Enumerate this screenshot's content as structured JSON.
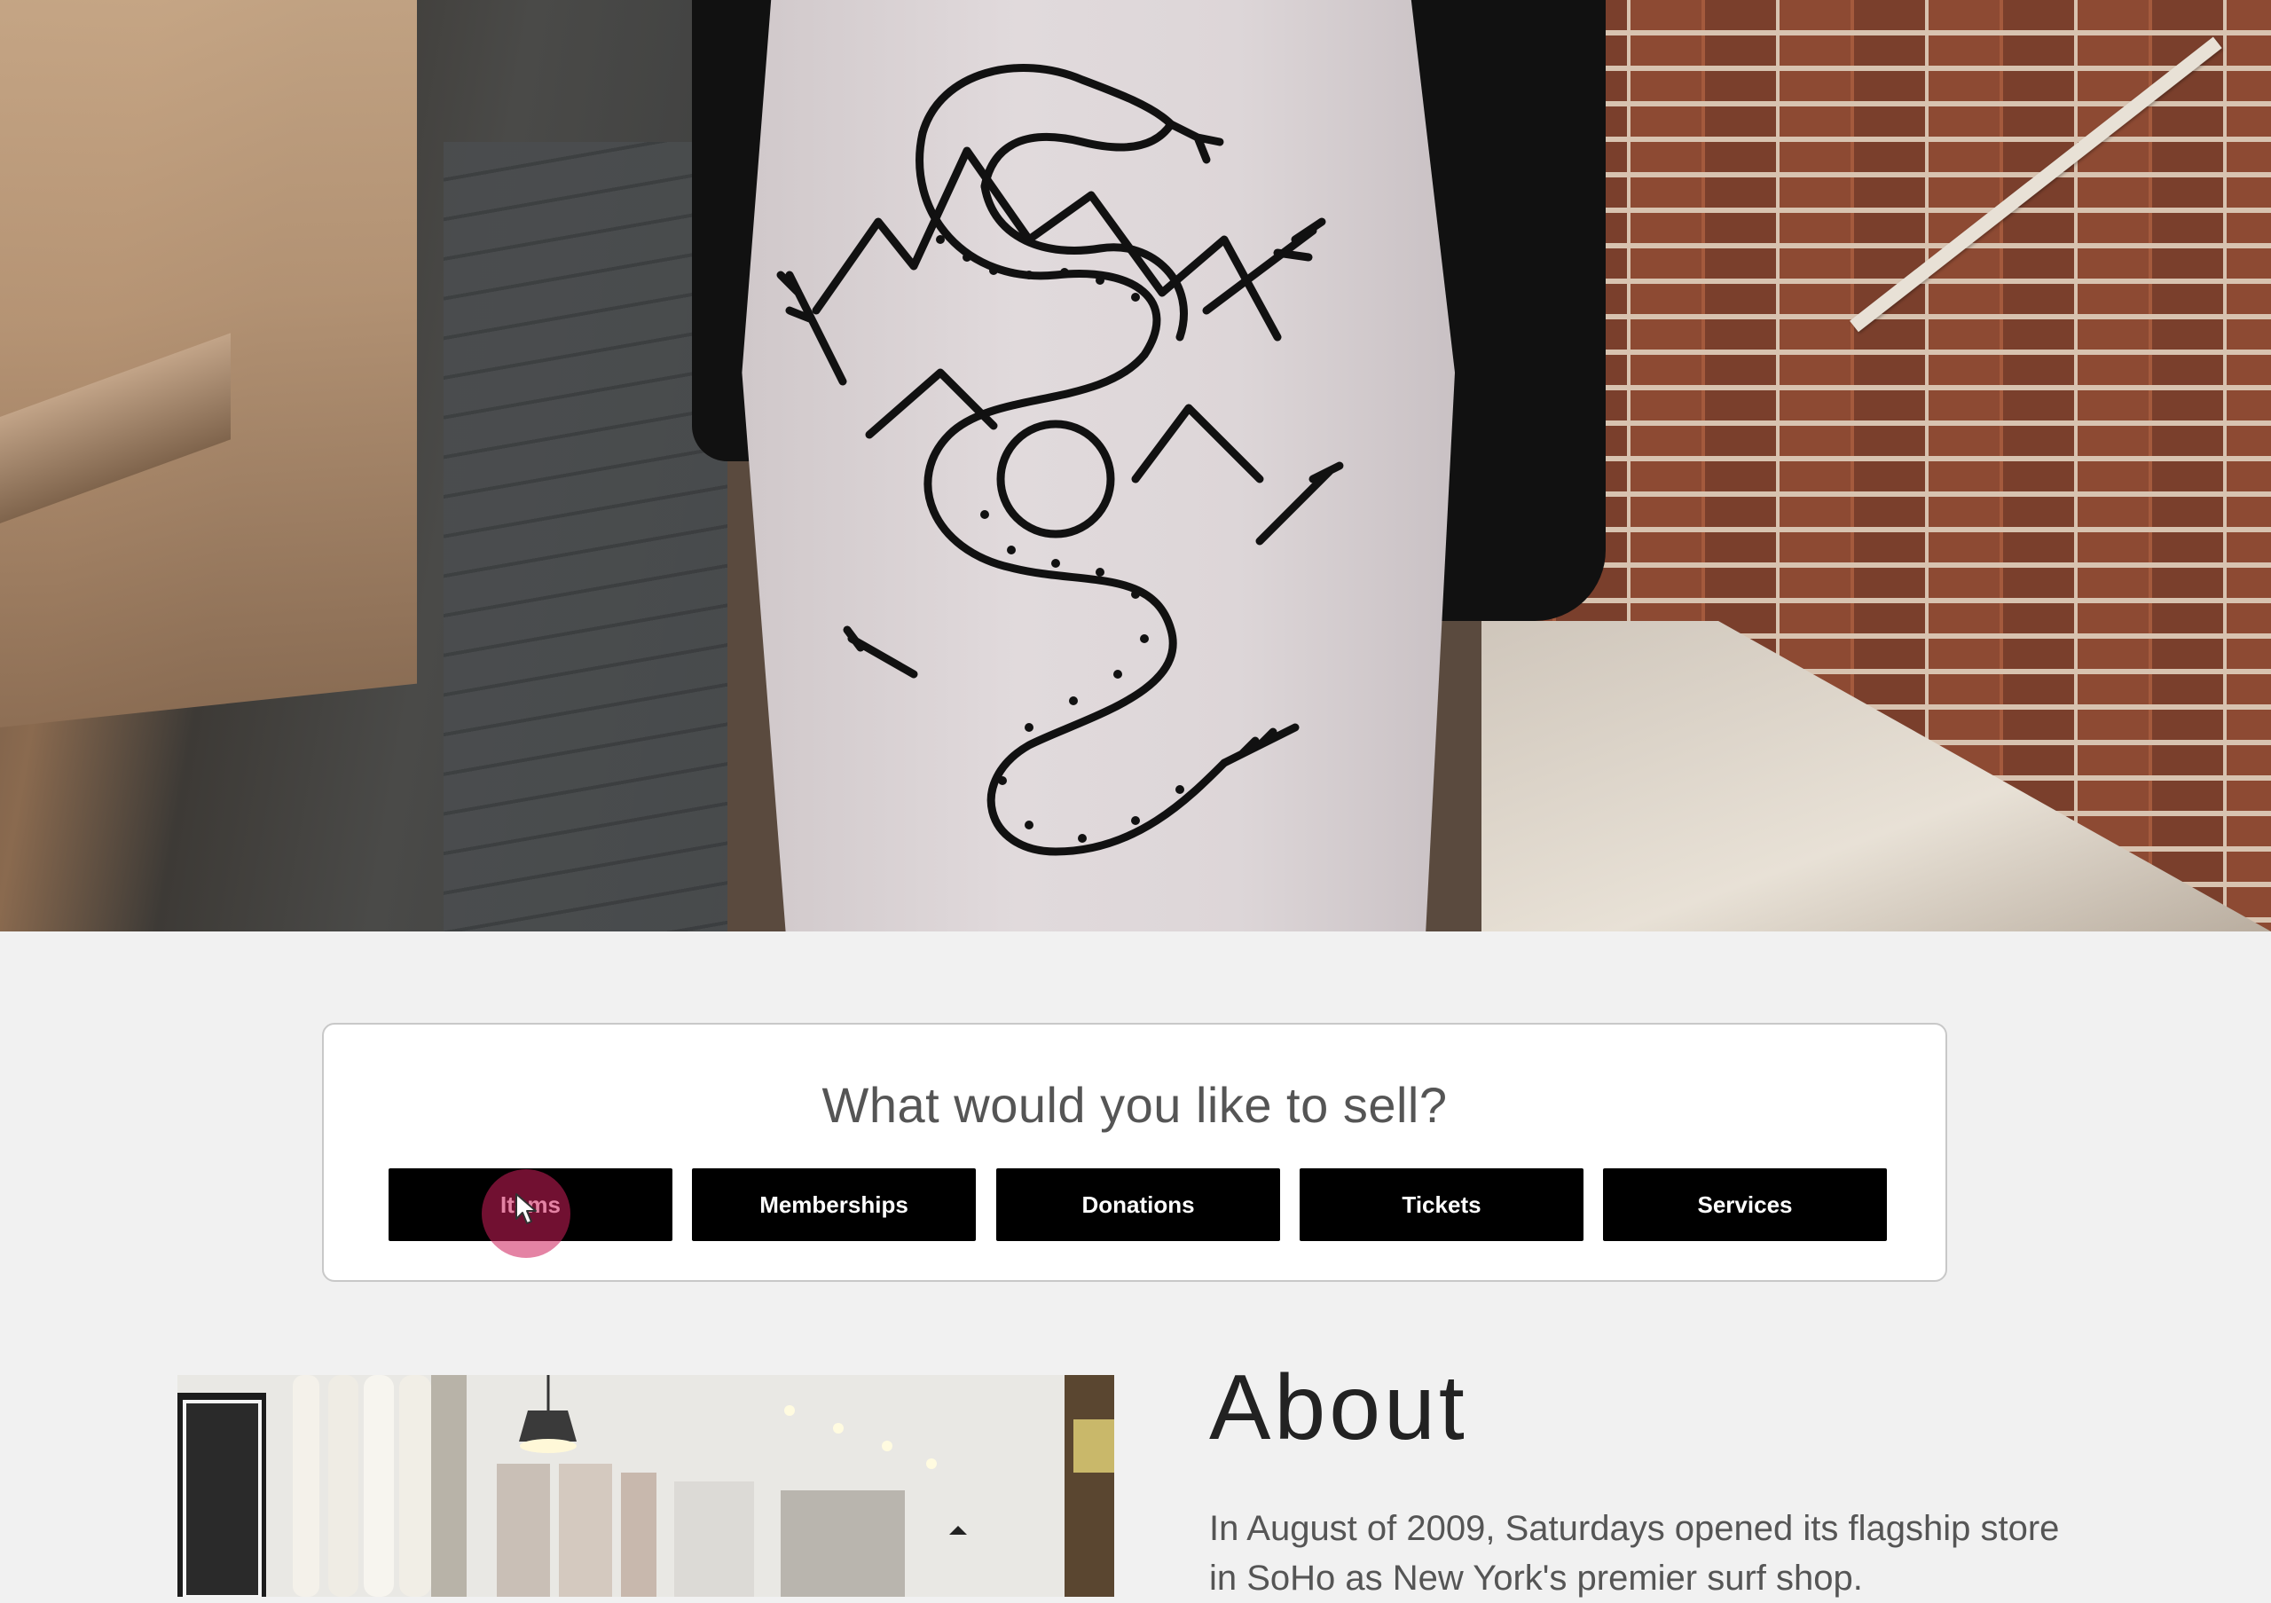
{
  "sell": {
    "heading": "What would you like to sell?",
    "options": [
      "Items",
      "Memberships",
      "Donations",
      "Tickets",
      "Services"
    ]
  },
  "about": {
    "title": "About",
    "body": "In August of 2009, Saturdays opened its flagship store in SoHo as New York's premier surf shop."
  },
  "theme": {
    "page_bg": "#f1f1f1",
    "card_bg": "#ffffff",
    "button_bg": "#000000",
    "button_text": "#ffffff",
    "click_highlight": "#cd1e5a"
  }
}
